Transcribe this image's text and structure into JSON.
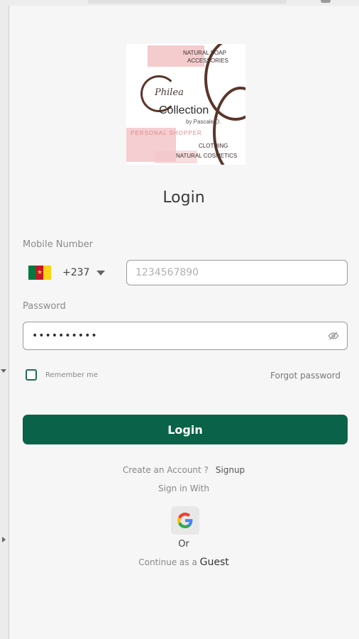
{
  "logo": {
    "line1": "NATURAL SOAP",
    "line2": "ACCESSORIES",
    "line3": "Philea",
    "line4": "Collection",
    "line5": "by Pascale D.",
    "line6": "PERSONAL SHOPPER",
    "line7": "CLOTHING",
    "line8": "NATURAL COSMETICS"
  },
  "page": {
    "title": "Login"
  },
  "form": {
    "mobile_label": "Mobile Number",
    "country_code": "+237",
    "phone_placeholder": "1234567890",
    "password_label": "Password",
    "password_value": "••••••••••",
    "remember_label": "Remember me",
    "forgot_label": "Forgot password",
    "login_button": "Login"
  },
  "footer": {
    "create_text": "Create an Account ?",
    "signup_label": "Signup",
    "sign_in_with": "Sign in With",
    "or_text": "Or",
    "continue_text": "Continue as a",
    "guest_label": "Guest"
  },
  "colors": {
    "primary": "#0a6348",
    "checkbox_border": "#1f6b57"
  },
  "icons": {
    "country_flag": "cameroon-flag-icon",
    "dropdown": "caret-down-icon",
    "password_toggle": "eye-off-icon",
    "social": "google-icon"
  }
}
